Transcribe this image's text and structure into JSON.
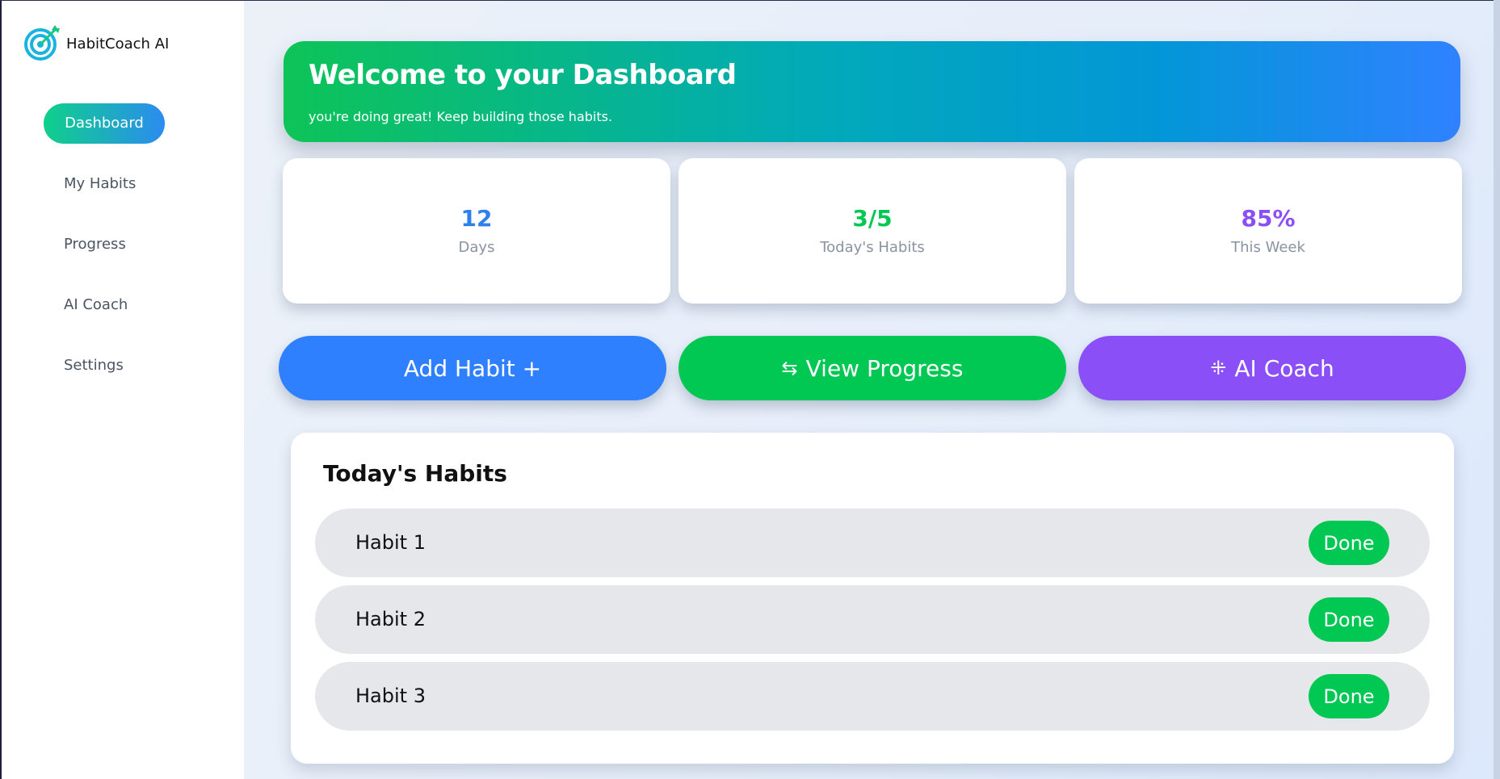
{
  "app": {
    "name": "HabitCoach AI",
    "logo_icon": "target-arrow-icon"
  },
  "sidebar": {
    "items": [
      {
        "label": "Dashboard",
        "active": true
      },
      {
        "label": "My Habits",
        "active": false
      },
      {
        "label": "Progress",
        "active": false
      },
      {
        "label": "AI Coach",
        "active": false
      },
      {
        "label": "Settings",
        "active": false
      }
    ]
  },
  "hero": {
    "title": "Welcome to your Dashboard",
    "subtitle": "you're doing great! Keep building those habits."
  },
  "stats": [
    {
      "value": "12",
      "label": "Days",
      "color": "#2f80ed"
    },
    {
      "value": "3/5",
      "label": "Today's Habits",
      "color": "#00c853"
    },
    {
      "value": "85%",
      "label": "This Week",
      "color": "#8b4ff7"
    }
  ],
  "actions": [
    {
      "label": "Add Habit +",
      "icon": "",
      "color": "#2f80ff"
    },
    {
      "label": "View Progress",
      "icon": "⇆",
      "color": "#00c853"
    },
    {
      "label": "AI Coach",
      "icon": "⁜",
      "color": "#8b4ff7"
    }
  ],
  "habits_panel": {
    "title": "Today's Habits",
    "habits": [
      {
        "name": "Habit 1",
        "button": "Done"
      },
      {
        "name": "Habit 2",
        "button": "Done"
      },
      {
        "name": "Habit 3",
        "button": "Done"
      }
    ]
  }
}
